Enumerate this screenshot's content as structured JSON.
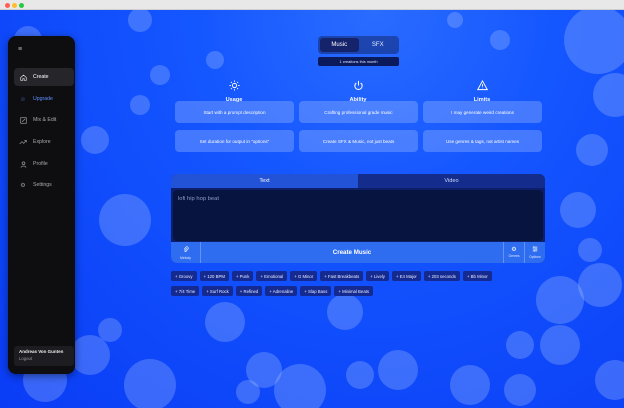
{
  "colors": {
    "background": "#0a35f0",
    "sidebar": "#0e0e10",
    "accent": "#2f6df0",
    "upgrade": "#5f90ff",
    "chip": "#152a90"
  },
  "sidebar": {
    "menu_icon": "hamburger-icon",
    "items": [
      {
        "label": "Create",
        "icon": "home-icon",
        "active": true
      },
      {
        "label": "Upgrade",
        "icon": "star-icon",
        "active": false
      },
      {
        "label": "Mix & Edit",
        "icon": "edit-icon",
        "active": false
      },
      {
        "label": "Explore",
        "icon": "trending-icon",
        "active": false
      },
      {
        "label": "Profile",
        "icon": "user-icon",
        "active": false
      },
      {
        "label": "Settings",
        "icon": "gear-icon",
        "active": false
      }
    ],
    "user": {
      "name": "Andreas Von Gunten",
      "logout": "Logout"
    }
  },
  "mode_toggle": {
    "options": [
      "Music",
      "SFX"
    ],
    "selected": "Music",
    "credits": "1 creations this month"
  },
  "features": [
    {
      "title": "Usage",
      "icon": "sun-icon",
      "cards": [
        "Start with a prompt description",
        "Set duration for output in \"options\""
      ]
    },
    {
      "title": "Ability",
      "icon": "power-icon",
      "cards": [
        "Crafting professional grade music",
        "Create SFX & Music, not just beats"
      ]
    },
    {
      "title": "Limits",
      "icon": "warning-icon",
      "cards": [
        "I may generate weird creations",
        "Use genres & tags, not artist names"
      ]
    }
  ],
  "prompt": {
    "tabs": [
      "Text",
      "Video"
    ],
    "active_tab": "Text",
    "value": "lofi hip hop beat",
    "melody_label": "Melody",
    "create_label": "Create Music",
    "genres_label": "Genres",
    "options_label": "Options"
  },
  "suggestions": [
    [
      "+ Groovy",
      "+ 120 BPM",
      "+ Punk",
      "+ Emotional",
      "+ G Minor",
      "+ Fast Breakbeats",
      "+ Lively",
      "+ E4 Major",
      "+ 203 seconds",
      "+ Bb Minor"
    ],
    [
      "+ 7/4 Time",
      "+ Surf Rock",
      "+ Refined",
      "+ Adrenaline",
      "+ Slap Bass",
      "+ Minimal Beats"
    ]
  ]
}
